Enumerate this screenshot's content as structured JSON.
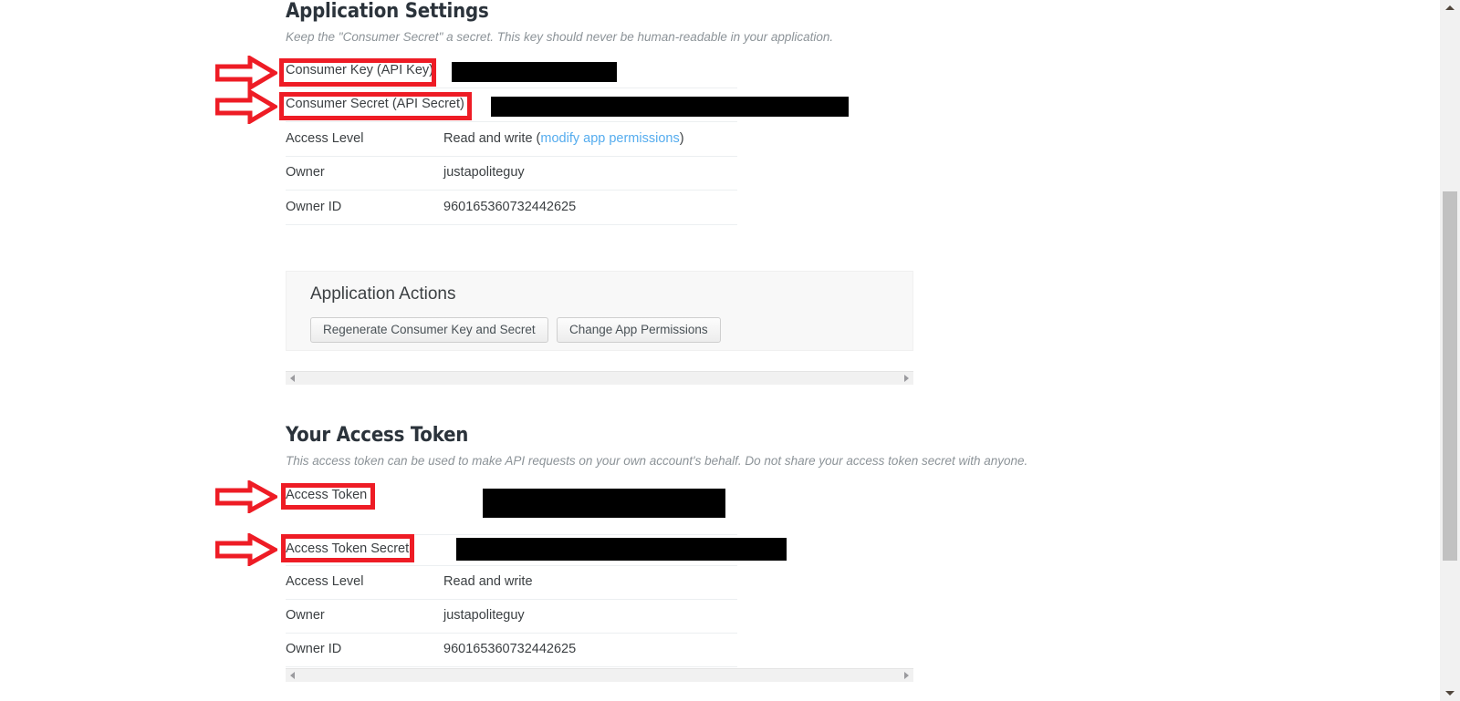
{
  "application_settings": {
    "title": "Application Settings",
    "subtitle": "Keep the \"Consumer Secret\" a secret. This key should never be human-readable in your application.",
    "rows": [
      {
        "label": "Consumer Key (API Key)",
        "value": "",
        "redacted": true
      },
      {
        "label": "Consumer Secret (API Secret)",
        "value": "",
        "redacted": true
      },
      {
        "label": "Access Level",
        "value": "Read and write (",
        "link": "modify app permissions",
        "value_suffix": ")"
      },
      {
        "label": "Owner",
        "value": "justapoliteguy"
      },
      {
        "label": "Owner ID",
        "value": "960165360732442625"
      }
    ]
  },
  "application_actions": {
    "title": "Application Actions",
    "buttons": [
      {
        "label": "Regenerate Consumer Key and Secret"
      },
      {
        "label": "Change App Permissions"
      }
    ]
  },
  "access_token": {
    "title": "Your Access Token",
    "subtitle": "This access token can be used to make API requests on your own account's behalf. Do not share your access token secret with anyone.",
    "rows": [
      {
        "label": "Access Token",
        "value": "",
        "redacted": true
      },
      {
        "label": "Access Token Secret",
        "value": "",
        "redacted": true
      },
      {
        "label": "Access Level",
        "value": "Read and write"
      },
      {
        "label": "Owner",
        "value": "justapoliteguy"
      },
      {
        "label": "Owner ID",
        "value": "960165360732442625"
      }
    ]
  },
  "annotations": {
    "color": "#ee1c25",
    "highlighted_labels": [
      "Consumer Key (API Key)",
      "Consumer Secret (API Secret)",
      "Access Token",
      "Access Token Secret"
    ]
  },
  "colors": {
    "link": "#55acee",
    "heading": "#2b333b",
    "subtitle": "#8c9398",
    "panel_background": "#f8f8f8",
    "redaction": "#000000",
    "annotation_red": "#ee1c25",
    "scrollbar_thumb": "#c1c1c1",
    "scrollbar_track": "#f1f1f1"
  }
}
